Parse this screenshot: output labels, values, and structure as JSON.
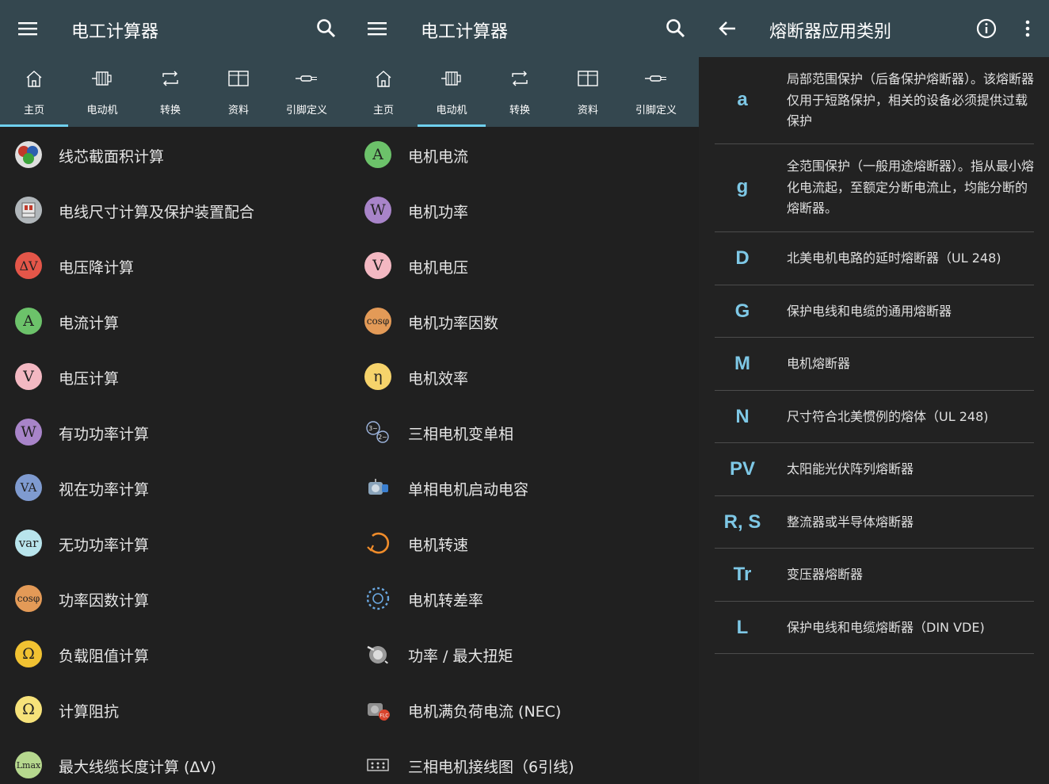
{
  "left_panel": {
    "title": "电工计算器",
    "tabs": [
      {
        "label": "主页",
        "icon": "home-icon"
      },
      {
        "label": "电动机",
        "icon": "motor-icon"
      },
      {
        "label": "转换",
        "icon": "convert-icon"
      },
      {
        "label": "资料",
        "icon": "book-icon"
      },
      {
        "label": "引脚定义",
        "icon": "connector-icon"
      }
    ],
    "active_tab": 0,
    "items": [
      {
        "label": "线芯截面积计算",
        "icon": "wire-cross-section-icon",
        "glyph": ""
      },
      {
        "label": "电线尺寸计算及保护装置配合",
        "icon": "breaker-icon",
        "glyph": ""
      },
      {
        "label": "电压降计算",
        "icon": "voltage-drop-icon",
        "glyph": "ΔV"
      },
      {
        "label": "电流计算",
        "icon": "current-icon",
        "glyph": "A"
      },
      {
        "label": "电压计算",
        "icon": "voltage-icon",
        "glyph": "V"
      },
      {
        "label": "有功功率计算",
        "icon": "active-power-icon",
        "glyph": "W"
      },
      {
        "label": "视在功率计算",
        "icon": "apparent-power-icon",
        "glyph": "VA"
      },
      {
        "label": "无功功率计算",
        "icon": "reactive-power-icon",
        "glyph": "var"
      },
      {
        "label": "功率因数计算",
        "icon": "power-factor-icon",
        "glyph": "cosφ"
      },
      {
        "label": "负载阻值计算",
        "icon": "resistance-icon",
        "glyph": "Ω"
      },
      {
        "label": "计算阻抗",
        "icon": "impedance-icon",
        "glyph": "Ω"
      },
      {
        "label": "最大线缆长度计算 (ΔV)",
        "icon": "cable-length-icon",
        "glyph": "Lmax"
      }
    ]
  },
  "middle_panel": {
    "title": "电工计算器",
    "tabs": [
      {
        "label": "主页",
        "icon": "home-icon"
      },
      {
        "label": "电动机",
        "icon": "motor-icon"
      },
      {
        "label": "转换",
        "icon": "convert-icon"
      },
      {
        "label": "资料",
        "icon": "book-icon"
      },
      {
        "label": "引脚定义",
        "icon": "connector-icon"
      }
    ],
    "active_tab": 1,
    "items": [
      {
        "label": "电机电流",
        "icon": "motor-current-icon",
        "glyph": "A"
      },
      {
        "label": "电机功率",
        "icon": "motor-power-icon",
        "glyph": "W"
      },
      {
        "label": "电机电压",
        "icon": "motor-voltage-icon",
        "glyph": "V"
      },
      {
        "label": "电机功率因数",
        "icon": "motor-power-factor-icon",
        "glyph": "cosφ"
      },
      {
        "label": "电机效率",
        "icon": "efficiency-icon",
        "glyph": "η"
      },
      {
        "label": "三相电机变单相",
        "icon": "phase-convert-icon",
        "glyph": ""
      },
      {
        "label": "单相电机启动电容",
        "icon": "capacitor-icon",
        "glyph": ""
      },
      {
        "label": "电机转速",
        "icon": "speed-icon",
        "glyph": ""
      },
      {
        "label": "电机转差率",
        "icon": "slip-icon",
        "glyph": ""
      },
      {
        "label": "功率 / 最大扭矩",
        "icon": "torque-icon",
        "glyph": ""
      },
      {
        "label": "电机满负荷电流 (NEC)",
        "icon": "flc-icon",
        "glyph": ""
      },
      {
        "label": "三相电机接线图（6引线)",
        "icon": "wiring-diagram-icon",
        "glyph": ""
      }
    ]
  },
  "right_panel": {
    "title": "熔断器应用类别",
    "fuses": [
      {
        "code": "a",
        "desc": "局部范围保护（后备保护熔断器）。该熔断器仅用于短路保护，相关的设备必须提供过载保护"
      },
      {
        "code": "g",
        "desc": "全范围保护（一般用途熔断器）。指从最小熔化电流起，至额定分断电流止，均能分断的熔断器。"
      },
      {
        "code": "D",
        "desc": "北美电机电路的延时熔断器（UL 248)"
      },
      {
        "code": "G",
        "desc": "保护电线和电缆的通用熔断器"
      },
      {
        "code": "M",
        "desc": "电机熔断器"
      },
      {
        "code": "N",
        "desc": "尺寸符合北美惯例的熔体（UL 248)"
      },
      {
        "code": "PV",
        "desc": "太阳能光伏阵列熔断器"
      },
      {
        "code": "R, S",
        "desc": "整流器或半导体熔断器"
      },
      {
        "code": "Tr",
        "desc": "变压器熔断器"
      },
      {
        "code": "L",
        "desc": "保护电线和电缆熔断器（DIN VDE)"
      }
    ]
  },
  "colors": {
    "appbar": "#34474f",
    "background": "#202020",
    "accent": "#6fd0ee",
    "fuse_code": "#7ec8e6"
  }
}
